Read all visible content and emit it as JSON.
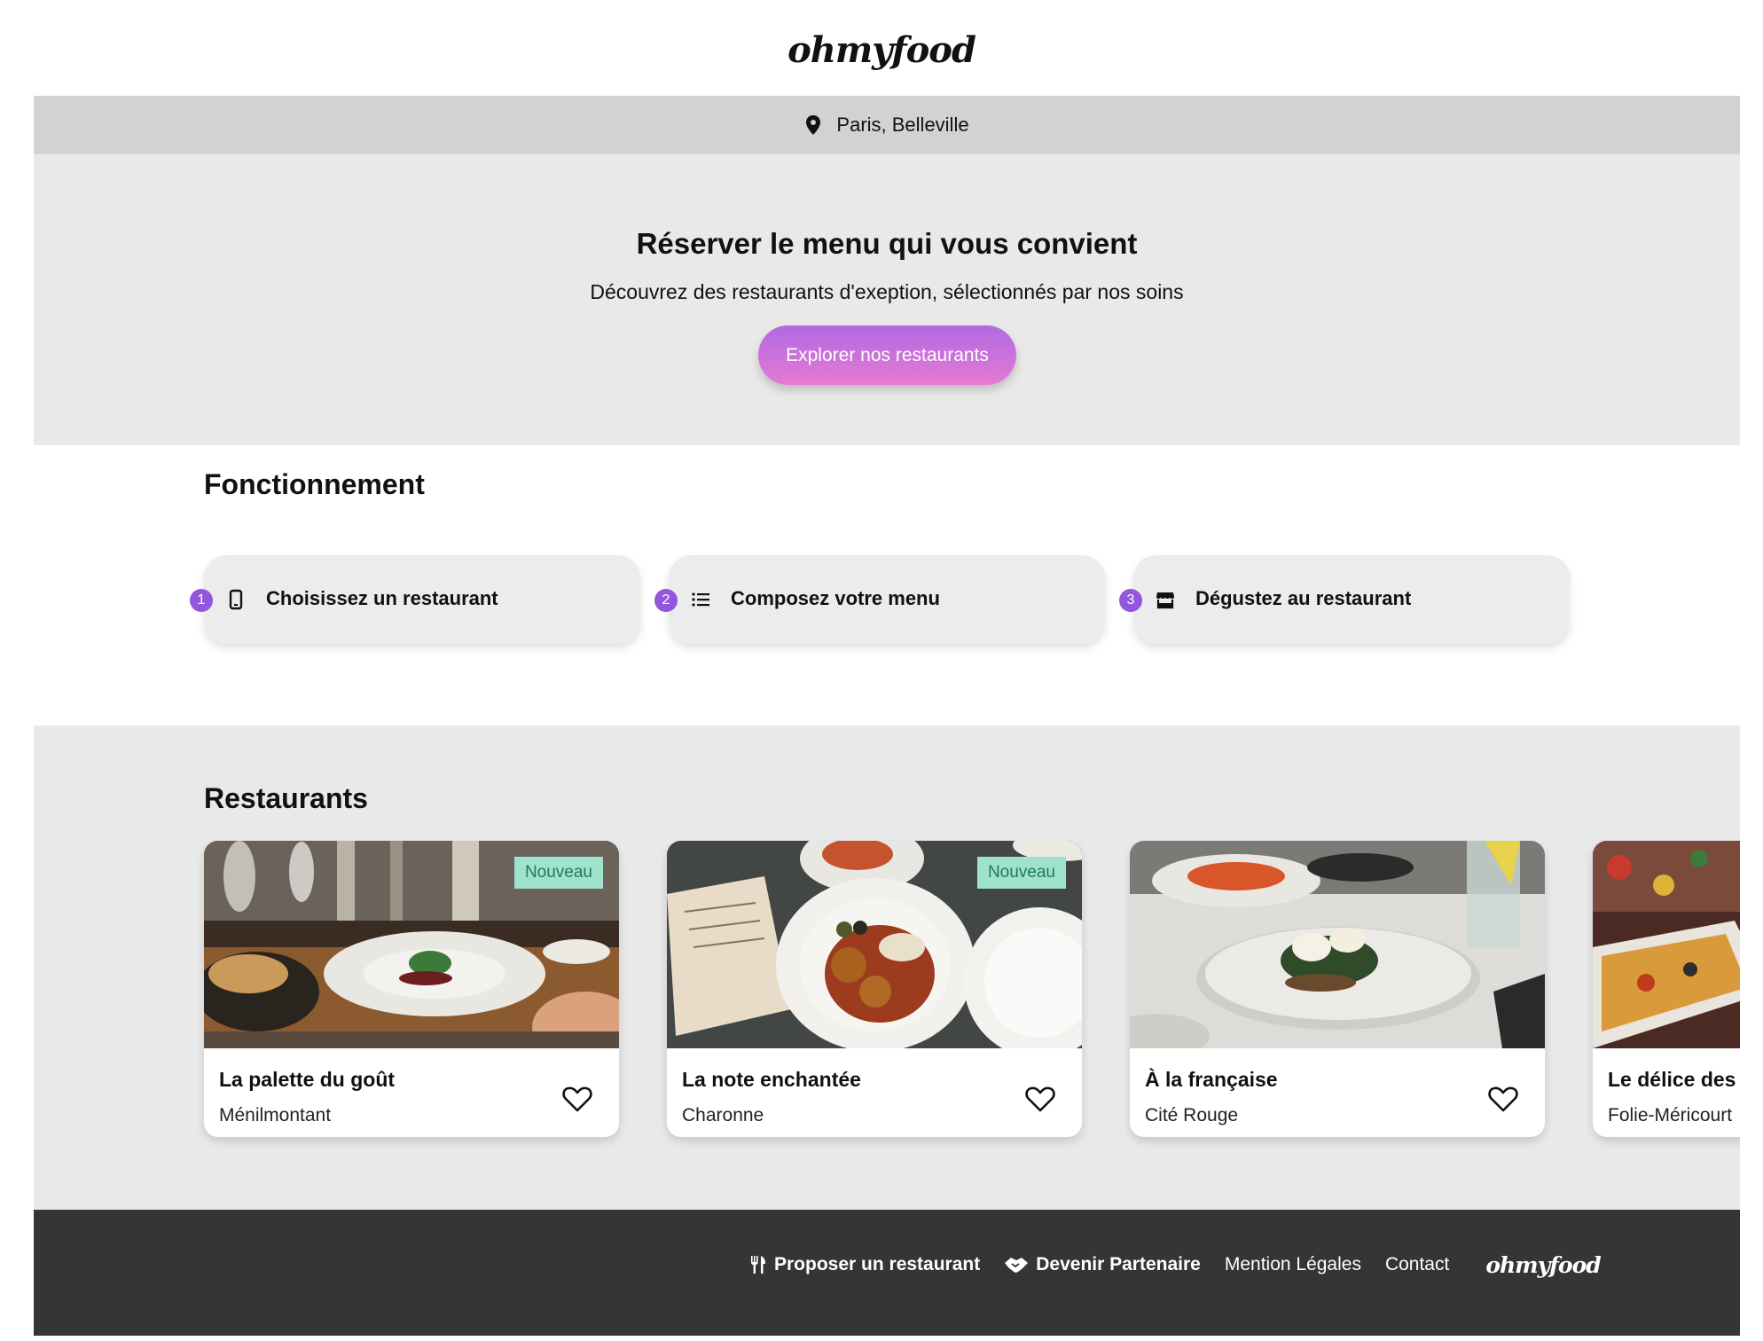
{
  "header": {
    "logo": "ohmyfood"
  },
  "location": {
    "icon": "map-pin-icon",
    "label": "Paris, Belleville"
  },
  "hero": {
    "title": "Réserver le menu qui vous convient",
    "subtitle": "Découvrez des restaurants d'exeption, sélectionnés par nos soins",
    "cta_label": "Explorer nos restaurants"
  },
  "how": {
    "title": "Fonctionnement",
    "steps": [
      {
        "number": "1",
        "icon": "smartphone-icon",
        "label": "Choisissez un restaurant"
      },
      {
        "number": "2",
        "icon": "list-icon",
        "label": "Composez votre menu"
      },
      {
        "number": "3",
        "icon": "store-icon",
        "label": "Dégustez au restaurant"
      }
    ]
  },
  "restaurants": {
    "title": "Restaurants",
    "items": [
      {
        "name": "La palette du goût",
        "area": "Ménilmontant",
        "badge": "Nouveau"
      },
      {
        "name": "La note enchantée",
        "area": "Charonne",
        "badge": "Nouveau"
      },
      {
        "name": "À la française",
        "area": "Cité Rouge",
        "badge": ""
      },
      {
        "name": "Le délice des",
        "area": "Folie-Méricourt",
        "badge": ""
      }
    ]
  },
  "footer": {
    "links": [
      {
        "icon": "utensils-icon",
        "label": "Proposer un restaurant"
      },
      {
        "icon": "handshake-icon",
        "label": "Devenir Partenaire"
      },
      {
        "label": "Mention Légales"
      },
      {
        "label": "Contact"
      }
    ],
    "logo": "ohmyfood"
  },
  "colors": {
    "accent_purple": "#9356dc",
    "badge_green": "#9fe3cd",
    "footer_bg": "#353535"
  }
}
